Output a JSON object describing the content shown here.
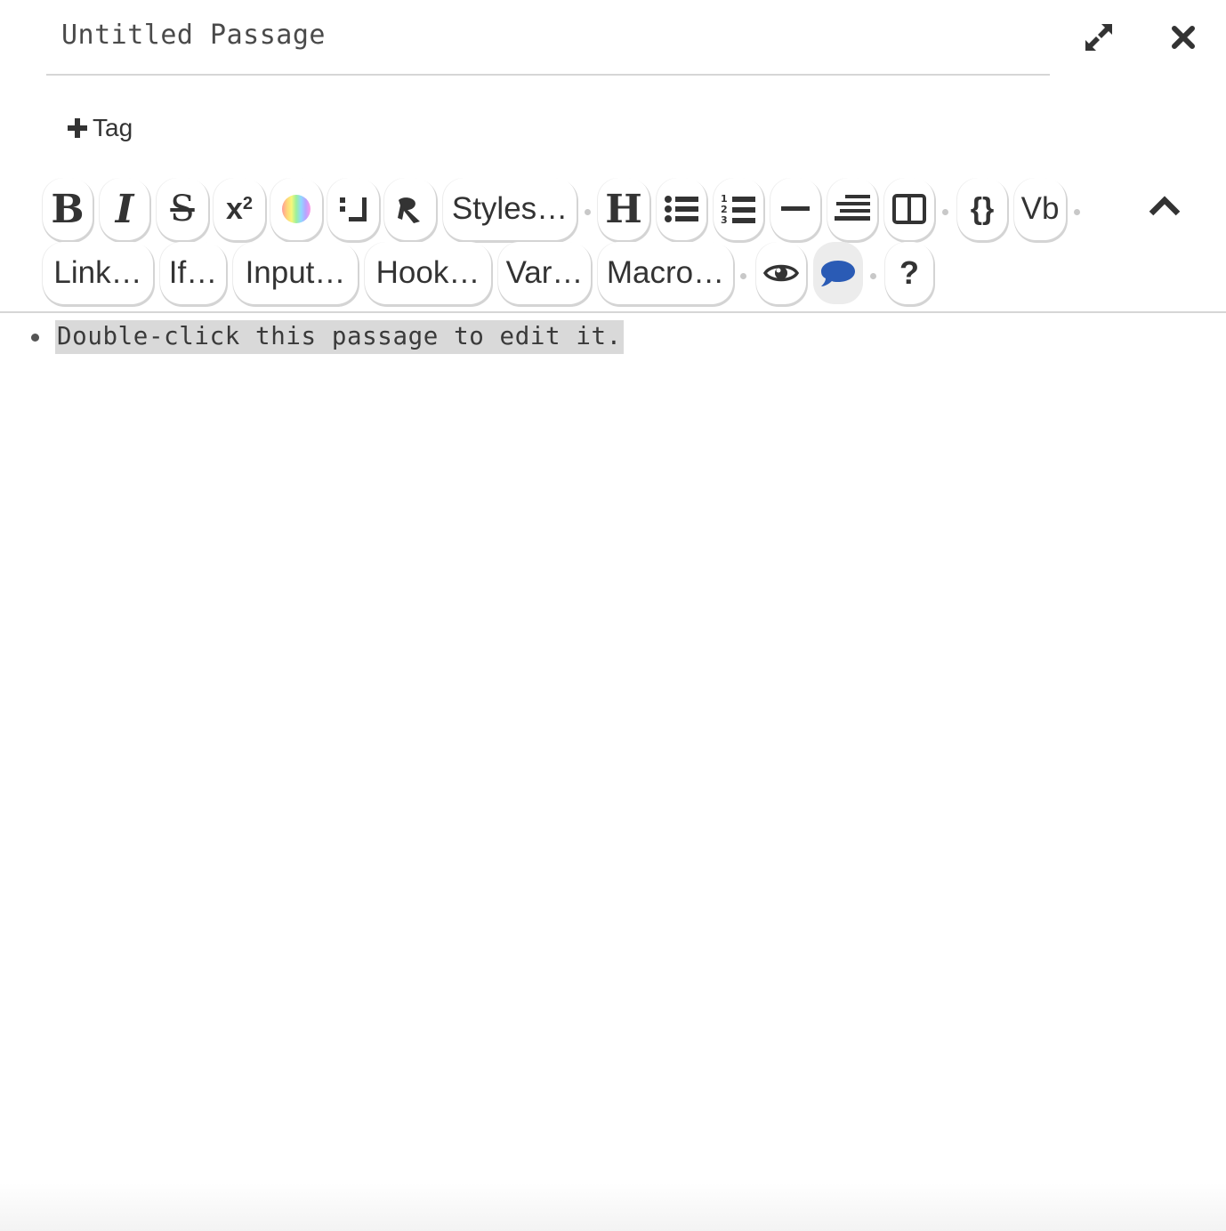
{
  "passage": {
    "title": "Untitled Passage",
    "body_text": "Double-click this passage to edit it."
  },
  "header": {
    "maximize_icon": "expand-arrows-icon",
    "close_icon": "close-x-icon"
  },
  "tags": {
    "add_label": "Tag"
  },
  "toolbar": {
    "row1": {
      "bold": "B",
      "italic": "I",
      "strikethrough": "S",
      "superscript": "x",
      "superscript_exp": "2",
      "styles": "Styles…",
      "heading": "H",
      "vertical_bar": "Vb",
      "braces": "{}"
    },
    "row2": {
      "link": "Link…",
      "if": "If…",
      "input": "Input…",
      "hook": "Hook…",
      "var": "Var…",
      "macro": "Macro…",
      "help": "?"
    },
    "accent_active": "#2a5bb5"
  }
}
